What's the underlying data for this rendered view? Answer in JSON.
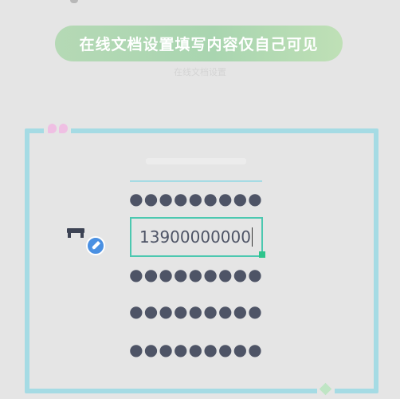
{
  "banner": {
    "text": "在线文档设置填写内容仅自己可见"
  },
  "subcaption": {
    "text": "在线文档设置"
  },
  "form": {
    "masked_rows": [
      "●●●●●●●●●●●",
      "●●●●●●●●●●●",
      "●●●●●●●●●●●",
      "●●●●●●●●●●●"
    ],
    "active_field": {
      "value": "13900000000"
    }
  },
  "icons": {
    "label_icon": "table-label-with-edit-pencil-icon",
    "decor_quote": "quote-mark-icon",
    "decor_sparkle": "sparkle-icon"
  },
  "colors": {
    "frame": "#a5dbe4",
    "banner": "#b0d8b2",
    "active_border": "#4cc8b0",
    "masked_text": "#4e5466",
    "edit_badge": "#4a90e2"
  }
}
